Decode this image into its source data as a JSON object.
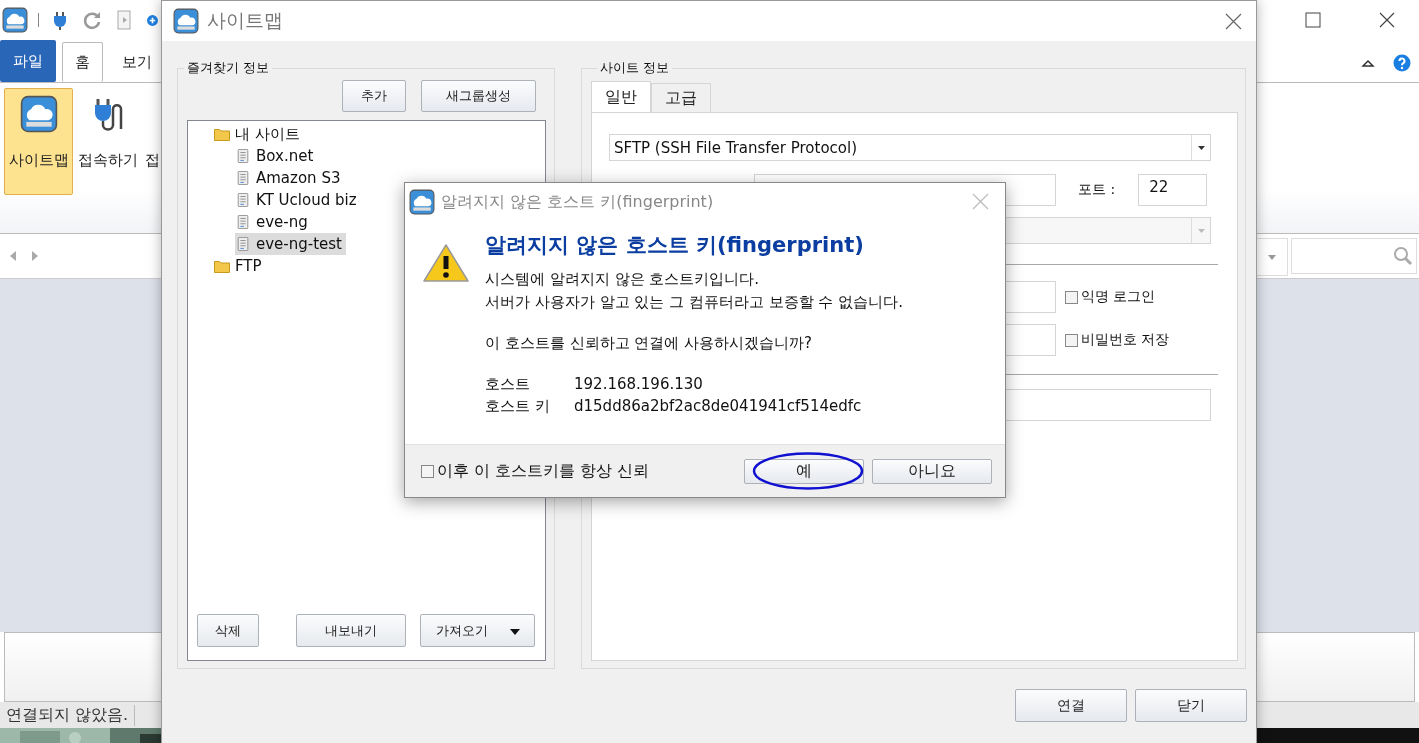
{
  "main_window": {
    "ribbon_tabs": [
      {
        "label": "파일",
        "kind": "menu",
        "selected": false
      },
      {
        "label": "홈",
        "kind": "tab",
        "selected": true
      },
      {
        "label": "보기",
        "kind": "tab",
        "selected": false
      }
    ],
    "ribbon_buttons": [
      {
        "label": "사이트맵",
        "kind": "sitemap",
        "selected": true
      },
      {
        "label": "접속하기",
        "kind": "connect",
        "selected": false
      },
      {
        "label": "접",
        "kind": "text",
        "selected": false
      }
    ],
    "status_bar": "연결되지 않았음."
  },
  "sitemap": {
    "title": "사이트맵",
    "favorites": {
      "title": "즐겨찾기 정보",
      "buttons": [
        "추가",
        "새그룹생성"
      ],
      "tree": [
        {
          "label": "내 사이트",
          "kind": "folder",
          "selected": false,
          "children": [
            {
              "label": "Box.net",
              "kind": "site",
              "selected": false
            },
            {
              "label": "Amazon S3",
              "kind": "site",
              "selected": false
            },
            {
              "label": "KT Ucloud biz",
              "kind": "site",
              "selected": false
            },
            {
              "label": "eve-ng",
              "kind": "site",
              "selected": false
            },
            {
              "label": "eve-ng-test",
              "kind": "site",
              "selected": true
            }
          ]
        },
        {
          "label": "FTP",
          "kind": "folder",
          "selected": false
        }
      ],
      "footer_buttons": [
        {
          "label": "삭제",
          "kind": "plain"
        },
        {
          "label": "내보내기",
          "kind": "plain"
        },
        {
          "label": "가져오기",
          "kind": "split"
        }
      ]
    },
    "site_info": {
      "title": "사이트 정보",
      "tabs": [
        {
          "label": "일반",
          "selected": true
        },
        {
          "label": "고급",
          "selected": false
        }
      ],
      "protocol": "SFTP (SSH File Transfer Protocol)",
      "port_label": "포트 :",
      "port": "22",
      "anonymous_login": {
        "label": "익명 로그인",
        "checked": false
      },
      "save_password": {
        "label": "비밀번호 저장",
        "checked": false
      }
    },
    "buttons": [
      "연결",
      "닫기"
    ]
  },
  "dialog": {
    "title": "알려지지 않은 호스트 키(fingerprint)",
    "heading": "알려지지 않은 호스트 키(fingerprint)",
    "message": [
      "시스템에 알려지지 않은 호스트키입니다.",
      "서버가 사용자가 알고 있는 그 컴퓨터라고 보증할 수 없습니다."
    ],
    "question": "이 호스트를 신뢰하고 연결에 사용하시겠습니까?",
    "details": [
      {
        "label": "호스트",
        "value": "192.168.196.130"
      },
      {
        "label": "호스트 키",
        "value": "d15dd86a2bf2ac8de041941cf514edfc"
      }
    ],
    "always_trust": {
      "label": "이후 이 호스트키를 항상 신뢰",
      "checked": false
    },
    "buttons": [
      {
        "label": "예",
        "circled": true
      },
      {
        "label": "아니요",
        "circled": false
      }
    ]
  }
}
